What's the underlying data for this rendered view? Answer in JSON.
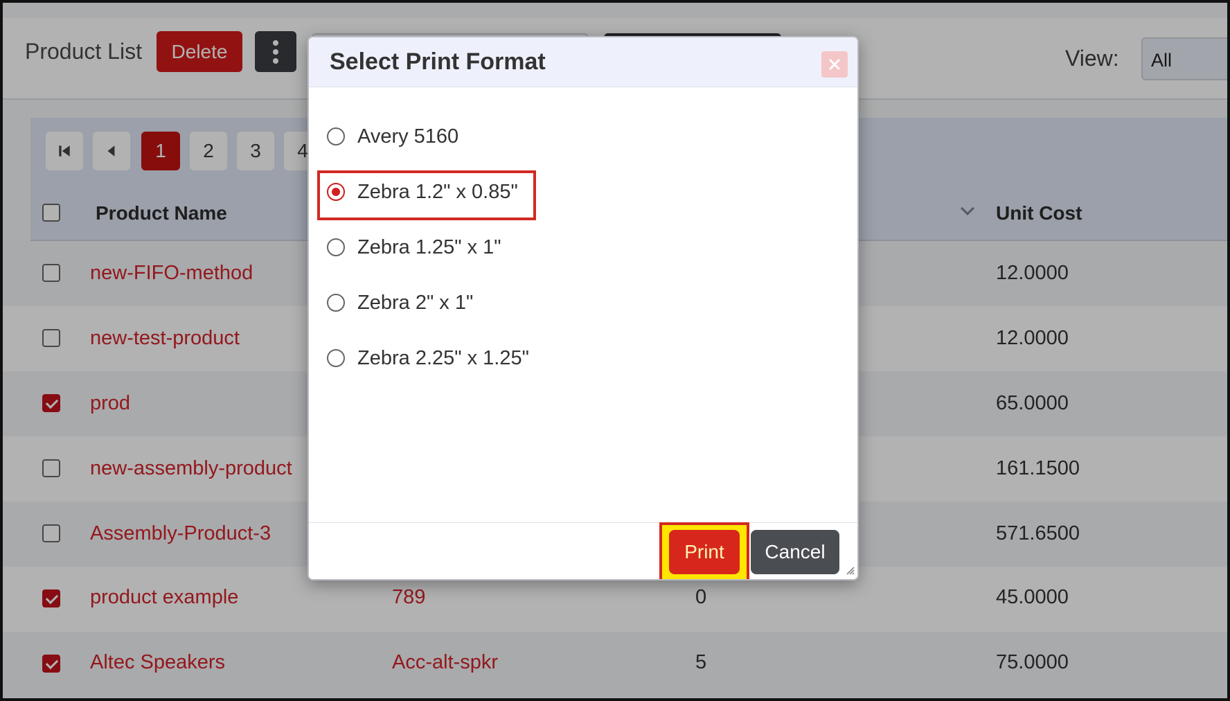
{
  "header": {
    "title": "Product List",
    "delete_label": "Delete",
    "view_label": "View:",
    "view_value": "All"
  },
  "pagination": {
    "pages": [
      "1",
      "2",
      "3",
      "4"
    ],
    "active_page": "1"
  },
  "table": {
    "columns": [
      "Product Name",
      "Unit Cost"
    ],
    "rows": [
      {
        "name": "new-FIFO-method",
        "sku": "",
        "qty": "",
        "unit_cost": "12.0000",
        "checked": false
      },
      {
        "name": "new-test-product",
        "sku": "",
        "qty": "",
        "unit_cost": "12.0000",
        "checked": false
      },
      {
        "name": "prod",
        "sku": "",
        "qty": "",
        "unit_cost": "65.0000",
        "checked": true
      },
      {
        "name": "new-assembly-product",
        "sku": "",
        "qty": "",
        "unit_cost": "161.1500",
        "checked": false
      },
      {
        "name": "Assembly-Product-3",
        "sku": "",
        "qty": "",
        "unit_cost": "571.6500",
        "checked": false
      },
      {
        "name": "product example",
        "sku": "789",
        "qty": "0",
        "unit_cost": "45.0000",
        "checked": true
      },
      {
        "name": "Altec Speakers",
        "sku": "Acc-alt-spkr",
        "qty": "5",
        "unit_cost": "75.0000",
        "checked": true
      }
    ]
  },
  "modal": {
    "title": "Select Print Format",
    "options": [
      {
        "label": "Avery 5160",
        "selected": false
      },
      {
        "label": "Zebra 1.2\" x 0.85\"",
        "selected": true
      },
      {
        "label": "Zebra 1.25\" x 1\"",
        "selected": false
      },
      {
        "label": "Zebra 2\" x 1\"",
        "selected": false
      },
      {
        "label": "Zebra 2.25\" x 1.25\"",
        "selected": false
      }
    ],
    "print_label": "Print",
    "cancel_label": "Cancel"
  },
  "colors": {
    "accent_red": "#d11a1a",
    "highlight_yellow": "#ffe600",
    "dark_button": "#4a4d52"
  },
  "icons": {
    "close": "close-icon",
    "first_page": "first-page-icon",
    "prev_page": "prev-page-icon",
    "kebab": "kebab-menu-icon",
    "sort": "chevron-down-icon",
    "resize": "resize-handle-icon"
  }
}
